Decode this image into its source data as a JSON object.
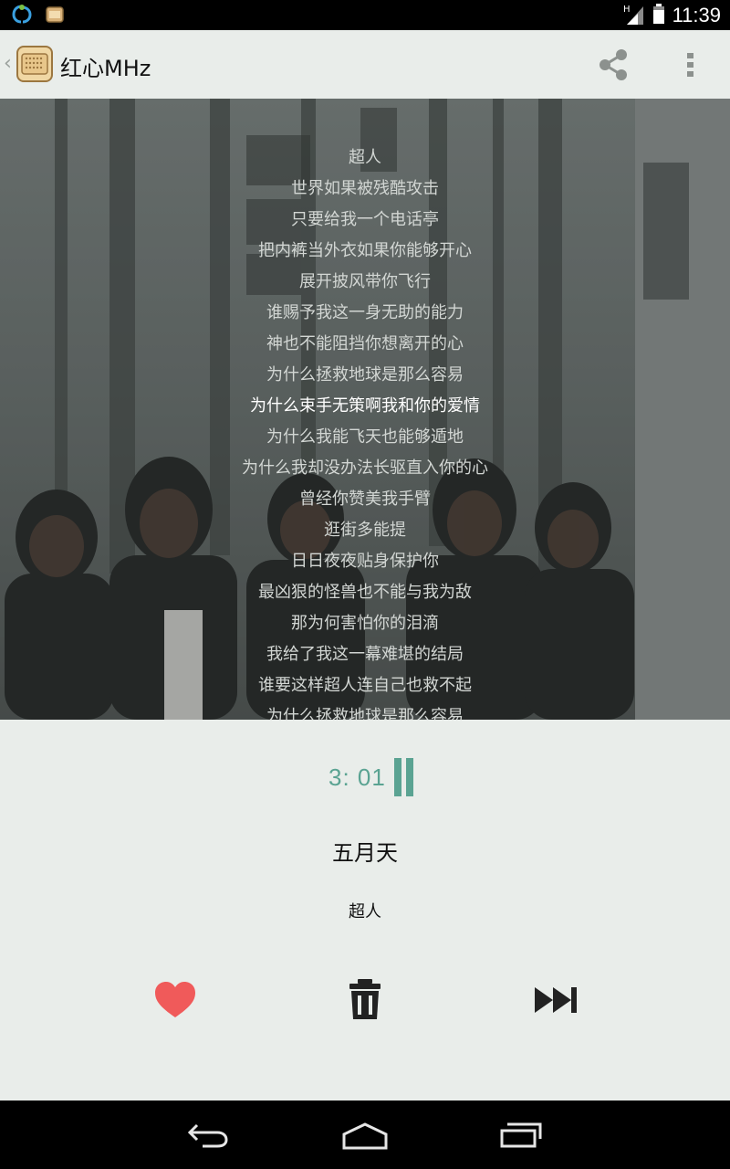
{
  "status_bar": {
    "time": "11:39",
    "icons": [
      "refresh-app-icon",
      "radio-app-icon",
      "signal-h-icon",
      "battery-icon"
    ]
  },
  "app_bar": {
    "title": "红心MHz",
    "icons": [
      "back-chevron-icon",
      "radio-icon",
      "share-icon",
      "overflow-menu-icon"
    ]
  },
  "lyrics": {
    "lines": [
      "超人",
      "世界如果被残酷攻击",
      "只要给我一个电话亭",
      "把内裤当外衣如果你能够开心",
      "展开披风带你飞行",
      "谁赐予我这一身无助的能力",
      "神也不能阻挡你想离开的心",
      "为什么拯救地球是那么容易",
      "为什么束手无策啊我和你的爱情",
      "为什么我能飞天也能够遁地",
      "为什么我却没办法长驱直入你的心",
      "曾经你赞美我手臂",
      "逛街多能提",
      "日日夜夜贴身保护你",
      "最凶狠的怪兽也不能与我为敌",
      "那为何害怕你的泪滴",
      "我给了我这一幕难堪的结局",
      "谁要这样超人连自己也救不起",
      "为什么拯救地球是那么容易"
    ],
    "current_index": 8
  },
  "player": {
    "time": "3: 01",
    "artist": "五月天",
    "song": "超人",
    "accent_color": "#5aa392",
    "like_color": "#f05a5a",
    "controls": [
      "heart-icon",
      "trash-icon",
      "skip-next-icon"
    ]
  },
  "nav_bar": {
    "icons": [
      "nav-back-icon",
      "nav-home-icon",
      "nav-recent-apps-icon"
    ]
  }
}
